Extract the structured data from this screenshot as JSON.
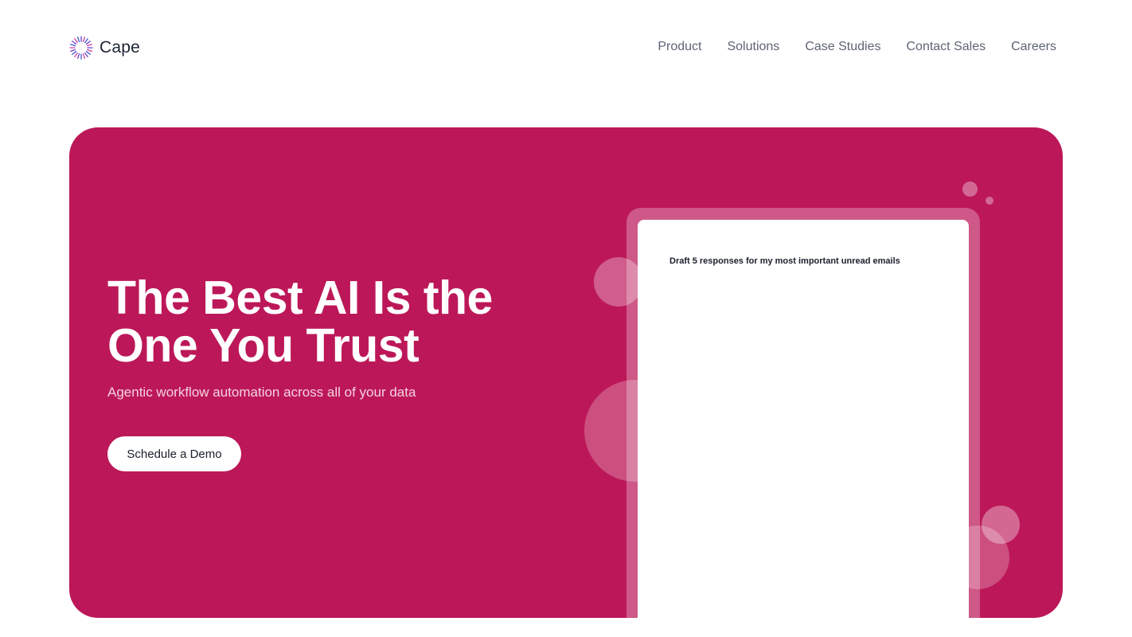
{
  "brand": {
    "name": "Cape",
    "logo_icon": "sunburst-logo-icon",
    "logo_colors": [
      "#6a3fd0",
      "#d23aa0",
      "#3c56d8"
    ]
  },
  "nav": {
    "items": [
      {
        "label": "Product"
      },
      {
        "label": "Solutions"
      },
      {
        "label": "Case Studies"
      },
      {
        "label": "Contact Sales"
      },
      {
        "label": "Careers"
      }
    ]
  },
  "hero": {
    "title": "The Best AI Is the One You Trust",
    "subtitle": "Agentic workflow automation across all of your data",
    "cta_label": "Schedule a Demo",
    "background_color": "#bc1859"
  },
  "demo": {
    "prompt": "Draft 5 responses for my most important unread emails"
  }
}
